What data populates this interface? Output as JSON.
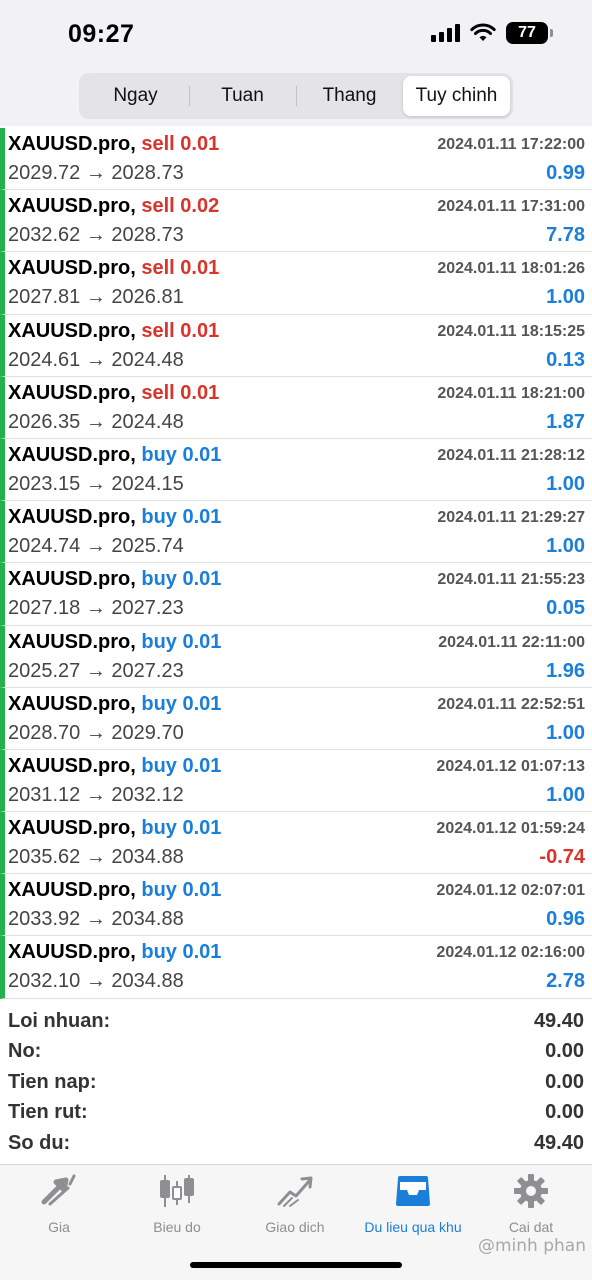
{
  "status_bar": {
    "time": "09:27",
    "battery": "77"
  },
  "period_tabs": [
    {
      "label": "Ngay",
      "active": false
    },
    {
      "label": "Tuan",
      "active": false
    },
    {
      "label": "Thang",
      "active": false
    },
    {
      "label": "Tuy chinh",
      "active": true
    }
  ],
  "trades": [
    {
      "symbol": "XAUUSD.pro,",
      "side": "sell",
      "side_label": "sell 0.01",
      "prices": "2029.72 → 2028.73",
      "time": "2024.01.11 17:22:00",
      "profit": "0.99"
    },
    {
      "symbol": "XAUUSD.pro,",
      "side": "sell",
      "side_label": "sell 0.02",
      "prices": "2032.62 → 2028.73",
      "time": "2024.01.11 17:31:00",
      "profit": "7.78"
    },
    {
      "symbol": "XAUUSD.pro,",
      "side": "sell",
      "side_label": "sell 0.01",
      "prices": "2027.81 → 2026.81",
      "time": "2024.01.11 18:01:26",
      "profit": "1.00"
    },
    {
      "symbol": "XAUUSD.pro,",
      "side": "sell",
      "side_label": "sell 0.01",
      "prices": "2024.61 → 2024.48",
      "time": "2024.01.11 18:15:25",
      "profit": "0.13"
    },
    {
      "symbol": "XAUUSD.pro,",
      "side": "sell",
      "side_label": "sell 0.01",
      "prices": "2026.35 → 2024.48",
      "time": "2024.01.11 18:21:00",
      "profit": "1.87"
    },
    {
      "symbol": "XAUUSD.pro,",
      "side": "buy",
      "side_label": "buy 0.01",
      "prices": "2023.15 → 2024.15",
      "time": "2024.01.11 21:28:12",
      "profit": "1.00"
    },
    {
      "symbol": "XAUUSD.pro,",
      "side": "buy",
      "side_label": "buy 0.01",
      "prices": "2024.74 → 2025.74",
      "time": "2024.01.11 21:29:27",
      "profit": "1.00"
    },
    {
      "symbol": "XAUUSD.pro,",
      "side": "buy",
      "side_label": "buy 0.01",
      "prices": "2027.18 → 2027.23",
      "time": "2024.01.11 21:55:23",
      "profit": "0.05"
    },
    {
      "symbol": "XAUUSD.pro,",
      "side": "buy",
      "side_label": "buy 0.01",
      "prices": "2025.27 → 2027.23",
      "time": "2024.01.11 22:11:00",
      "profit": "1.96"
    },
    {
      "symbol": "XAUUSD.pro,",
      "side": "buy",
      "side_label": "buy 0.01",
      "prices": "2028.70 → 2029.70",
      "time": "2024.01.11 22:52:51",
      "profit": "1.00"
    },
    {
      "symbol": "XAUUSD.pro,",
      "side": "buy",
      "side_label": "buy 0.01",
      "prices": "2031.12 → 2032.12",
      "time": "2024.01.12 01:07:13",
      "profit": "1.00"
    },
    {
      "symbol": "XAUUSD.pro,",
      "side": "buy",
      "side_label": "buy 0.01",
      "prices": "2035.62 → 2034.88",
      "time": "2024.01.12 01:59:24",
      "profit": "-0.74"
    },
    {
      "symbol": "XAUUSD.pro,",
      "side": "buy",
      "side_label": "buy 0.01",
      "prices": "2033.92 → 2034.88",
      "time": "2024.01.12 02:07:01",
      "profit": "0.96"
    },
    {
      "symbol": "XAUUSD.pro,",
      "side": "buy",
      "side_label": "buy 0.01",
      "prices": "2032.10 → 2034.88",
      "time": "2024.01.12 02:16:00",
      "profit": "2.78"
    }
  ],
  "summary": [
    {
      "label": "Loi nhuan:",
      "value": "49.40"
    },
    {
      "label": "No:",
      "value": "0.00"
    },
    {
      "label": "Tien nap:",
      "value": "0.00"
    },
    {
      "label": "Tien rut:",
      "value": "0.00"
    },
    {
      "label": "So du:",
      "value": "49.40"
    }
  ],
  "tab_bar": [
    {
      "label": "Gia",
      "icon": "quotes-arrows-icon",
      "active": false
    },
    {
      "label": "Bieu do",
      "icon": "candlestick-chart-icon",
      "active": false
    },
    {
      "label": "Giao dich",
      "icon": "trade-trend-icon",
      "active": false
    },
    {
      "label": "Du lieu qua khu",
      "icon": "history-inbox-icon",
      "active": true
    },
    {
      "label": "Cai dat",
      "icon": "gear-icon",
      "active": false
    }
  ],
  "watermark": "@minh phan",
  "colors": {
    "sell": "#d9342b",
    "buy": "#1b7fd9",
    "profit_positive": "#1b7fd9",
    "profit_negative": "#d9342b",
    "row_marker": "#22b14c",
    "active_tab": "#1b7fd9",
    "inactive_tab": "#8e8e93"
  }
}
